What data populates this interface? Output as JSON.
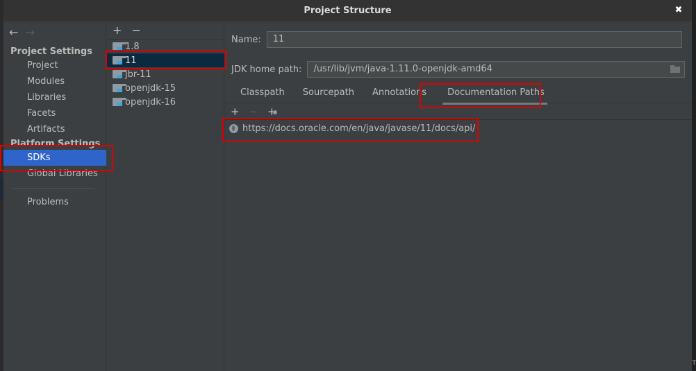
{
  "window": {
    "title": "Project Structure",
    "close_icon": "close-icon"
  },
  "nav": {
    "back_icon": "←",
    "forward_icon": "→",
    "sections": [
      {
        "title": "Project Settings",
        "items": [
          "Project",
          "Modules",
          "Libraries",
          "Facets",
          "Artifacts"
        ]
      },
      {
        "title": "Platform Settings",
        "items": [
          "SDKs",
          "Global Libraries"
        ]
      }
    ],
    "other_items": [
      "Problems"
    ],
    "selected": "SDKs"
  },
  "sdk_panel": {
    "add_label": "+",
    "remove_label": "−",
    "items": [
      "1.8",
      "11",
      "jbr-11",
      "openjdk-15",
      "openjdk-16"
    ],
    "selected": "11"
  },
  "details": {
    "name_label": "Name:",
    "name_value": "11",
    "jdk_home_label": "JDK home path:",
    "jdk_home_value": "/usr/lib/jvm/java-1.11.0-openjdk-amd64",
    "tabs": [
      "Classpath",
      "Sourcepath",
      "Annotations",
      "Documentation Paths"
    ],
    "active_tab": "Documentation Paths",
    "doc_toolbar": {
      "add": "+",
      "remove": "−",
      "add_url": "+"
    },
    "doc_paths": [
      "https://docs.oracle.com/en/java/javase/11/docs/api/"
    ]
  },
  "colors": {
    "selection_blue": "#2f65ca",
    "tree_selection": "#0d293e",
    "highlight_red": "#e00000"
  }
}
